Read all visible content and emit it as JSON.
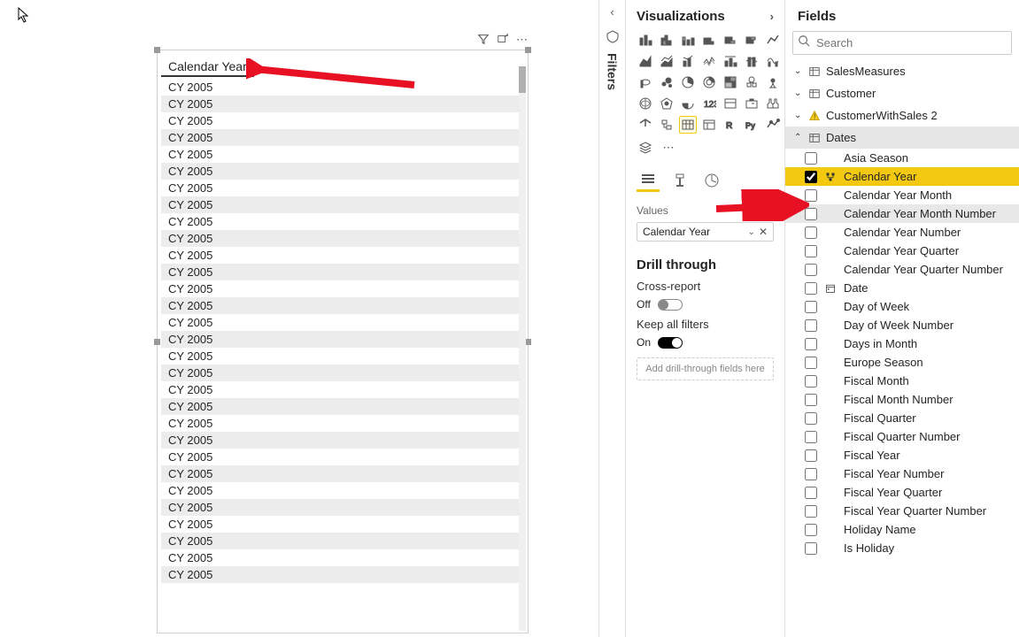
{
  "canvas": {
    "visual_header": "Calendar Year",
    "row_value": "CY 2005",
    "row_count": 30
  },
  "filters": {
    "label": "Filters"
  },
  "viz_pane": {
    "title": "Visualizations",
    "values_label": "Values",
    "field_in_well": "Calendar Year",
    "drill_title": "Drill through",
    "cross_report_label": "Cross-report",
    "cross_report_state": "Off",
    "keep_filters_label": "Keep all filters",
    "keep_filters_state": "On",
    "drop_zone_text": "Add drill-through fields here"
  },
  "fields_pane": {
    "title": "Fields",
    "search_placeholder": "Search",
    "tables": [
      {
        "name": "SalesMeasures",
        "icon": "table",
        "expanded": false
      },
      {
        "name": "Customer",
        "icon": "table",
        "expanded": false
      },
      {
        "name": "CustomerWithSales 2",
        "icon": "warn",
        "expanded": false
      },
      {
        "name": "Dates",
        "icon": "table",
        "expanded": true
      }
    ],
    "date_fields": [
      {
        "name": "Asia Season",
        "checked": false,
        "icon": ""
      },
      {
        "name": "Calendar Year",
        "checked": true,
        "icon": "hier",
        "highlight": "sel"
      },
      {
        "name": "Calendar Year Month",
        "checked": false,
        "icon": ""
      },
      {
        "name": "Calendar Year Month Number",
        "checked": false,
        "icon": "",
        "highlight": "hilite"
      },
      {
        "name": "Calendar Year Number",
        "checked": false,
        "icon": ""
      },
      {
        "name": "Calendar Year Quarter",
        "checked": false,
        "icon": ""
      },
      {
        "name": "Calendar Year Quarter Number",
        "checked": false,
        "icon": ""
      },
      {
        "name": "Date",
        "checked": false,
        "icon": "cal"
      },
      {
        "name": "Day of Week",
        "checked": false,
        "icon": ""
      },
      {
        "name": "Day of Week Number",
        "checked": false,
        "icon": ""
      },
      {
        "name": "Days in Month",
        "checked": false,
        "icon": ""
      },
      {
        "name": "Europe Season",
        "checked": false,
        "icon": ""
      },
      {
        "name": "Fiscal Month",
        "checked": false,
        "icon": ""
      },
      {
        "name": "Fiscal Month Number",
        "checked": false,
        "icon": ""
      },
      {
        "name": "Fiscal Quarter",
        "checked": false,
        "icon": ""
      },
      {
        "name": "Fiscal Quarter Number",
        "checked": false,
        "icon": ""
      },
      {
        "name": "Fiscal Year",
        "checked": false,
        "icon": ""
      },
      {
        "name": "Fiscal Year Number",
        "checked": false,
        "icon": ""
      },
      {
        "name": "Fiscal Year Quarter",
        "checked": false,
        "icon": ""
      },
      {
        "name": "Fiscal Year Quarter Number",
        "checked": false,
        "icon": ""
      },
      {
        "name": "Holiday Name",
        "checked": false,
        "icon": ""
      },
      {
        "name": "Is Holiday",
        "checked": false,
        "icon": ""
      }
    ]
  }
}
